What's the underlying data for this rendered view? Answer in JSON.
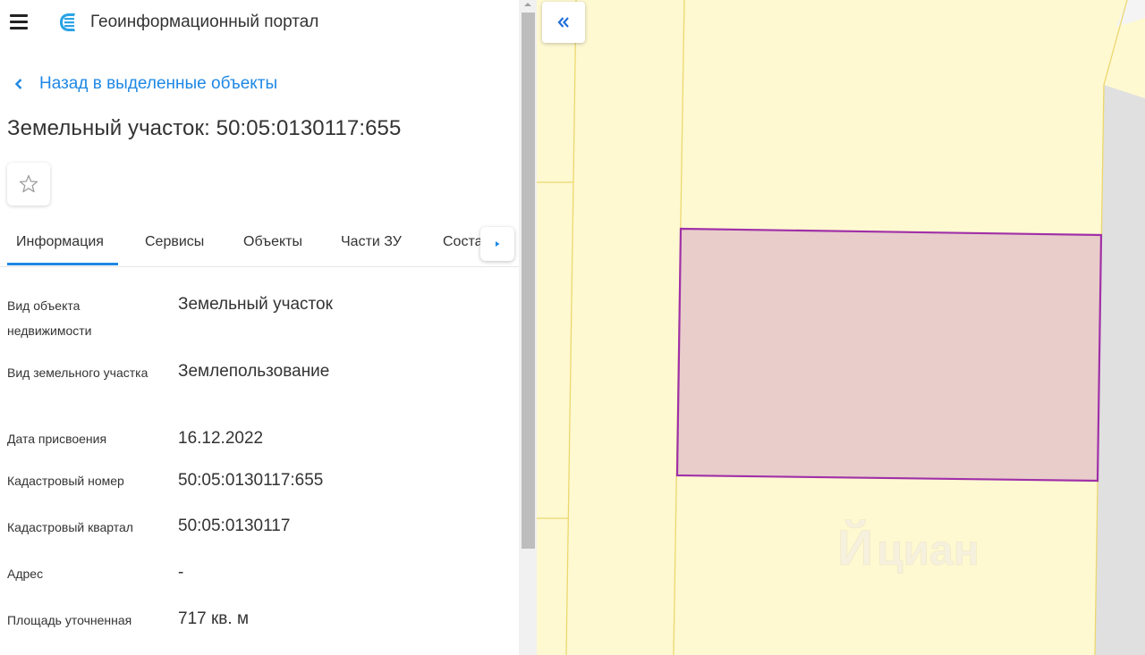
{
  "header": {
    "app_title": "Геоинформационный портал"
  },
  "back_link": {
    "label": "Назад в выделенные объекты"
  },
  "object": {
    "title": "Земельный участок: 50:05:0130117:655"
  },
  "tabs": [
    {
      "label": "Информация",
      "active": true
    },
    {
      "label": "Сервисы",
      "active": false
    },
    {
      "label": "Объекты",
      "active": false
    },
    {
      "label": "Части ЗУ",
      "active": false
    },
    {
      "label": "Соста",
      "active": false
    }
  ],
  "properties": [
    {
      "label": "Вид объекта недвижимости",
      "value": "Земельный участок"
    },
    {
      "label": "Вид земельного участка",
      "value": "Землепользование"
    },
    {
      "label": "Дата присвоения",
      "value": "16.12.2022"
    },
    {
      "label": "Кадастровый номер",
      "value": "50:05:0130117:655"
    },
    {
      "label": "Кадастровый квартал",
      "value": "50:05:0130117"
    },
    {
      "label": "Адрес",
      "value": "-"
    },
    {
      "label": "Площадь уточненная",
      "value": "717 кв. м"
    }
  ],
  "map": {
    "watermark": "циан",
    "colors": {
      "parcel_fill": "#fff9d2",
      "parcel_border": "#f0dc78",
      "selected_fill": "#e8cdca",
      "selected_border": "#a030a8",
      "outside": "#e0e0e0"
    }
  },
  "colors": {
    "accent": "#1e88e5"
  }
}
